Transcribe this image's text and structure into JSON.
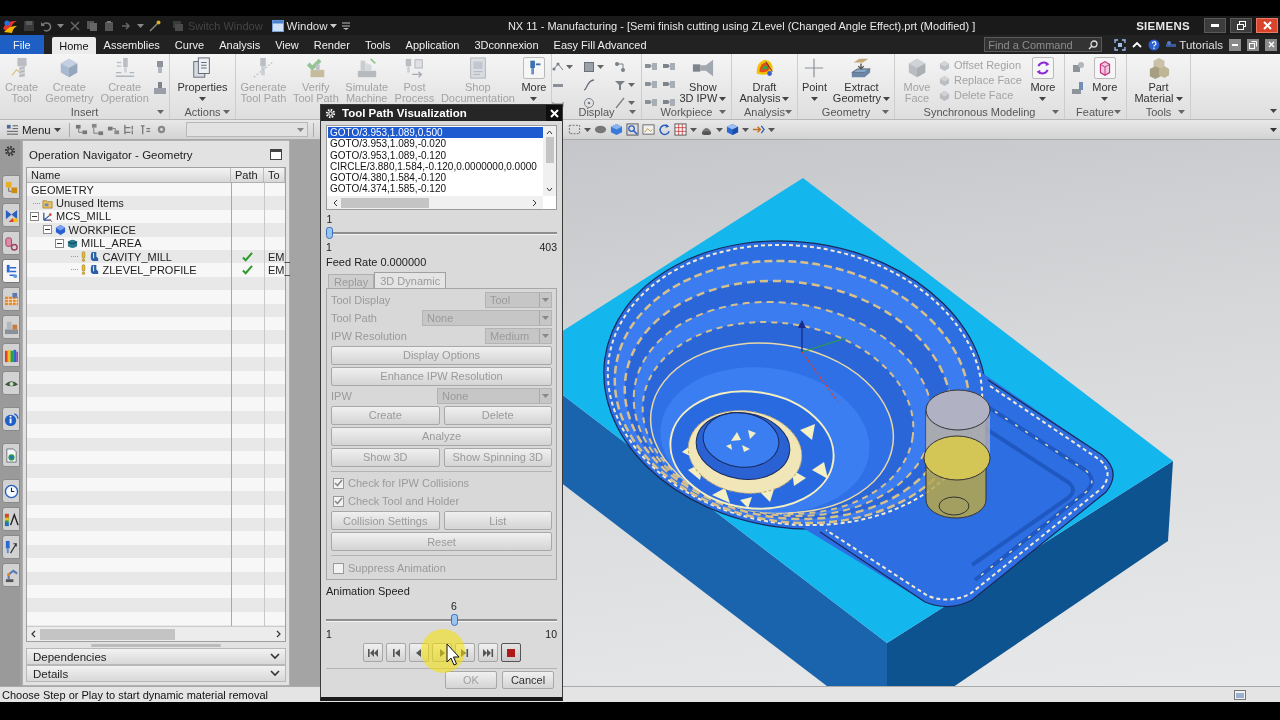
{
  "title_bar": {
    "switch_window": {
      "label": "Switch Window",
      "disabled": true
    },
    "window_menu": "Window",
    "title": "NX 11 - Manufacturing - [Semi finish cutting using ZLevel (Changed Angle Effect).prt (Modified) ]",
    "brand": "SIEMENS"
  },
  "menu_tabs": [
    {
      "label": "File",
      "kind": "file",
      "selected": false
    },
    {
      "label": "Home",
      "kind": "tab",
      "selected": true
    },
    {
      "label": "Assemblies",
      "kind": "tab",
      "selected": false
    },
    {
      "label": "Curve",
      "kind": "tab",
      "selected": false
    },
    {
      "label": "Analysis",
      "kind": "tab",
      "selected": false
    },
    {
      "label": "View",
      "kind": "tab",
      "selected": false
    },
    {
      "label": "Render",
      "kind": "tab",
      "selected": false
    },
    {
      "label": "Tools",
      "kind": "tab",
      "selected": false
    },
    {
      "label": "Application",
      "kind": "tab",
      "selected": false
    },
    {
      "label": "3Dconnexion",
      "kind": "tab",
      "selected": false
    },
    {
      "label": "Easy Fill Advanced",
      "kind": "tab",
      "selected": false
    }
  ],
  "command_search": {
    "placeholder": "Find a Command"
  },
  "help": {
    "label": "Tutorials"
  },
  "ribbon": [
    {
      "label": "Insert",
      "commands": [
        {
          "kind": "large",
          "lines": [
            "Create",
            "Tool"
          ],
          "dropdown": false,
          "disabled": true
        },
        {
          "kind": "large",
          "lines": [
            "Create",
            "Geometry"
          ],
          "dropdown": false,
          "disabled": true
        },
        {
          "kind": "large",
          "lines": [
            "Create",
            "Operation"
          ],
          "dropdown": false,
          "disabled": true
        },
        {
          "kind": "icons"
        }
      ]
    },
    {
      "label": "Actions",
      "commands": [
        {
          "kind": "large",
          "lines": [
            "Properties"
          ],
          "dropdown": true,
          "disabled": false
        }
      ]
    },
    {
      "commands": [
        {
          "kind": "large",
          "lines": [
            "Generate",
            "Tool Path"
          ],
          "dropdown": false,
          "disabled": true
        },
        {
          "kind": "large",
          "lines": [
            "Verify",
            "Tool Path"
          ],
          "dropdown": false,
          "disabled": true
        },
        {
          "kind": "large",
          "lines": [
            "Simulate",
            "Machine"
          ],
          "dropdown": false,
          "disabled": true
        },
        {
          "kind": "large",
          "lines": [
            "Post",
            "Process"
          ],
          "dropdown": false,
          "disabled": true
        },
        {
          "kind": "large",
          "lines": [
            "Shop",
            "Documentation"
          ],
          "dropdown": false,
          "disabled": true
        },
        {
          "kind": "large",
          "lines": [
            "More"
          ],
          "dropdown": true,
          "disabled": false
        }
      ]
    },
    {
      "label": "Display",
      "commands": [
        {
          "kind": "icons"
        }
      ]
    },
    {
      "label": "Workpiece",
      "commands": [
        {
          "kind": "icons"
        },
        {
          "kind": "large",
          "lines": [
            "Show",
            "3D IPW"
          ],
          "dropdown": true,
          "disabled": false
        }
      ]
    },
    {
      "label": "Analysis",
      "commands": [
        {
          "kind": "large",
          "lines": [
            "Draft",
            "Analysis"
          ],
          "dropdown": true,
          "disabled": false
        }
      ]
    },
    {
      "label": "Geometry",
      "commands": [
        {
          "kind": "large",
          "lines": [
            "Point"
          ],
          "dropdown": true,
          "disabled": false
        },
        {
          "kind": "large",
          "lines": [
            "Extract",
            "Geometry"
          ],
          "dropdown": true,
          "disabled": false
        }
      ]
    },
    {
      "label": "Synchronous Modeling",
      "commands": [
        {
          "kind": "large",
          "lines": [
            "Move",
            "Face"
          ],
          "dropdown": false,
          "disabled": true
        },
        {
          "kind": "small",
          "label": "Offset Region",
          "disabled": true
        },
        {
          "kind": "small",
          "label": "Replace Face",
          "disabled": true
        },
        {
          "kind": "small",
          "label": "Delete Face",
          "disabled": true
        },
        {
          "kind": "large",
          "lines": [
            "More"
          ],
          "dropdown": true,
          "disabled": false
        }
      ]
    },
    {
      "label": "Feature",
      "commands": [
        {
          "kind": "icons"
        },
        {
          "kind": "large",
          "lines": [
            "More"
          ],
          "dropdown": true,
          "disabled": false
        }
      ]
    },
    {
      "label": "Tools",
      "commands": [
        {
          "kind": "large",
          "lines": [
            "Part",
            "Material"
          ],
          "dropdown": true,
          "disabled": false
        }
      ]
    }
  ],
  "toolbar": {
    "menu_button": "Menu",
    "filter_field": {
      "disabled": true
    }
  },
  "resource_bar": [
    {
      "selected": false
    },
    {
      "selected": false
    },
    {
      "selected": false
    },
    {
      "selected": true
    },
    {
      "selected": false
    },
    {
      "selected": false
    },
    {
      "selected": false
    },
    {
      "selected": false
    },
    {
      "selected": false
    },
    {
      "selected": false
    },
    {
      "selected": false
    },
    {
      "selected": false
    },
    {
      "selected": false
    },
    {
      "selected": false
    }
  ],
  "navigator": {
    "title": "Operation Navigator - Geometry",
    "columns": [
      "Name",
      "Path",
      "To"
    ],
    "tree": [
      {
        "name": "GEOMETRY",
        "kind": "root",
        "children": [
          {
            "name": "Unused Items",
            "kind": "folder"
          },
          {
            "name": "MCS_MILL",
            "kind": "mcs",
            "expanded": true,
            "children": [
              {
                "name": "WORKPIECE",
                "kind": "workpiece",
                "expanded": true,
                "children": [
                  {
                    "name": "MILL_AREA",
                    "kind": "mill_area",
                    "expanded": true,
                    "children": [
                      {
                        "name": "CAVITY_MILL",
                        "kind": "operation",
                        "path_ok": true,
                        "tool": "EM_"
                      },
                      {
                        "name": "ZLEVEL_PROFILE",
                        "kind": "operation",
                        "path_ok": true,
                        "tool": "EM_"
                      }
                    ]
                  }
                ]
              }
            ]
          }
        ]
      }
    ],
    "panels": [
      {
        "label": "Dependencies",
        "expanded": false
      },
      {
        "label": "Details",
        "expanded": false
      }
    ]
  },
  "dialog": {
    "title": "Tool Path Visualization",
    "path_list": [
      {
        "text": "GOTO/3.953,1.089,0.500",
        "selected": true
      },
      {
        "text": "GOTO/3.953,1.089,-0.020",
        "selected": false
      },
      {
        "text": "GOTO/3.953,1.089,-0.120",
        "selected": false
      },
      {
        "text": "CIRCLE/3.880,1.584,-0.120,0.0000000,0.0000",
        "selected": false
      },
      {
        "text": "GOTO/4.380,1.584,-0.120",
        "selected": false
      },
      {
        "text": "GOTO/4.374,1.585,-0.120",
        "selected": false
      }
    ],
    "step_slider": {
      "value_label": "1",
      "min_label": "1",
      "max_label": "403",
      "level": 0
    },
    "feed_rate": "Feed Rate 0.000000",
    "tabs": [
      {
        "label": "Replay",
        "selected": false
      },
      {
        "label": "3D Dynamic",
        "selected": true
      }
    ],
    "panel": {
      "disabled": true,
      "rows": [
        {
          "kind": "dropdown",
          "label": "Tool Display",
          "value": "Tool"
        },
        {
          "kind": "dropdown",
          "label": "Tool Path",
          "value": "None"
        },
        {
          "kind": "dropdown",
          "label": "IPW Resolution",
          "value": "Medium"
        },
        {
          "kind": "button",
          "label": "Display Options"
        },
        {
          "kind": "button",
          "label": "Enhance IPW Resolution"
        },
        {
          "kind": "dropdown",
          "label": "IPW",
          "value": "None"
        },
        {
          "kind": "button_pair",
          "labels": [
            "Create",
            "Delete"
          ]
        },
        {
          "kind": "button",
          "label": "Analyze"
        },
        {
          "kind": "button_pair",
          "labels": [
            "Show 3D",
            "Show Spinning 3D"
          ]
        },
        {
          "kind": "separator"
        },
        {
          "kind": "checkbox",
          "label": "Check for IPW Collisions",
          "checked": true
        },
        {
          "kind": "checkbox",
          "label": "Check Tool and Holder",
          "checked": true
        },
        {
          "kind": "button_pair",
          "labels": [
            "Collision Settings",
            "List"
          ]
        },
        {
          "kind": "button",
          "label": "Reset"
        },
        {
          "kind": "separator"
        },
        {
          "kind": "checkbox",
          "label": "Suppress Animation",
          "checked": false
        }
      ]
    },
    "speed": {
      "label": "Animation Speed",
      "value_label": "6",
      "min_label": "1",
      "max_label": "10",
      "level": 0.556
    },
    "actions": [
      {
        "label": "OK",
        "disabled": true
      },
      {
        "label": "Cancel",
        "disabled": false
      }
    ]
  },
  "status_bar": {
    "message": "Choose Step or Play to start dynamic material removal"
  }
}
